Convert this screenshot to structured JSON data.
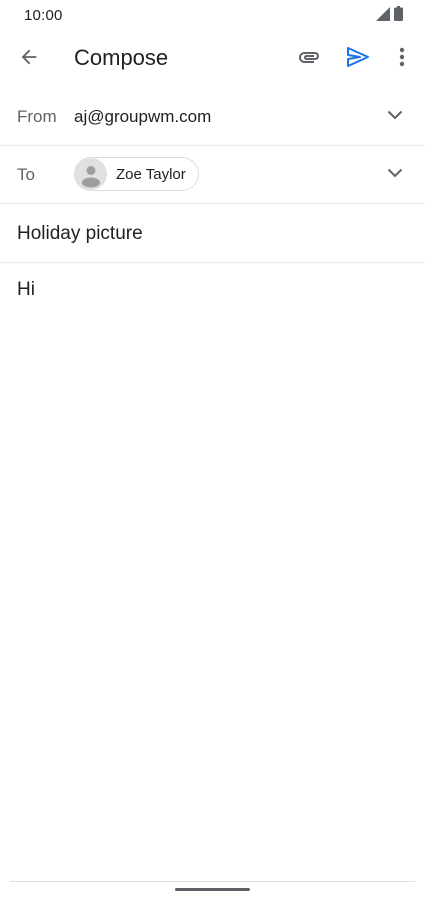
{
  "status_bar": {
    "time": "10:00",
    "icons": [
      "cellular-signal-icon",
      "battery-icon"
    ]
  },
  "app_bar": {
    "title": "Compose",
    "icons": {
      "back": "arrow-back-icon",
      "attach": "paperclip-icon",
      "send": "send-icon",
      "more": "more-vert-icon"
    },
    "send_color": "#1a73e8"
  },
  "from": {
    "label": "From",
    "value": "aj@groupwm.com"
  },
  "to": {
    "label": "To",
    "recipients": [
      {
        "name": "Zoe Taylor"
      }
    ]
  },
  "subject": {
    "value": "Holiday picture"
  },
  "body": {
    "text": "Hi"
  }
}
